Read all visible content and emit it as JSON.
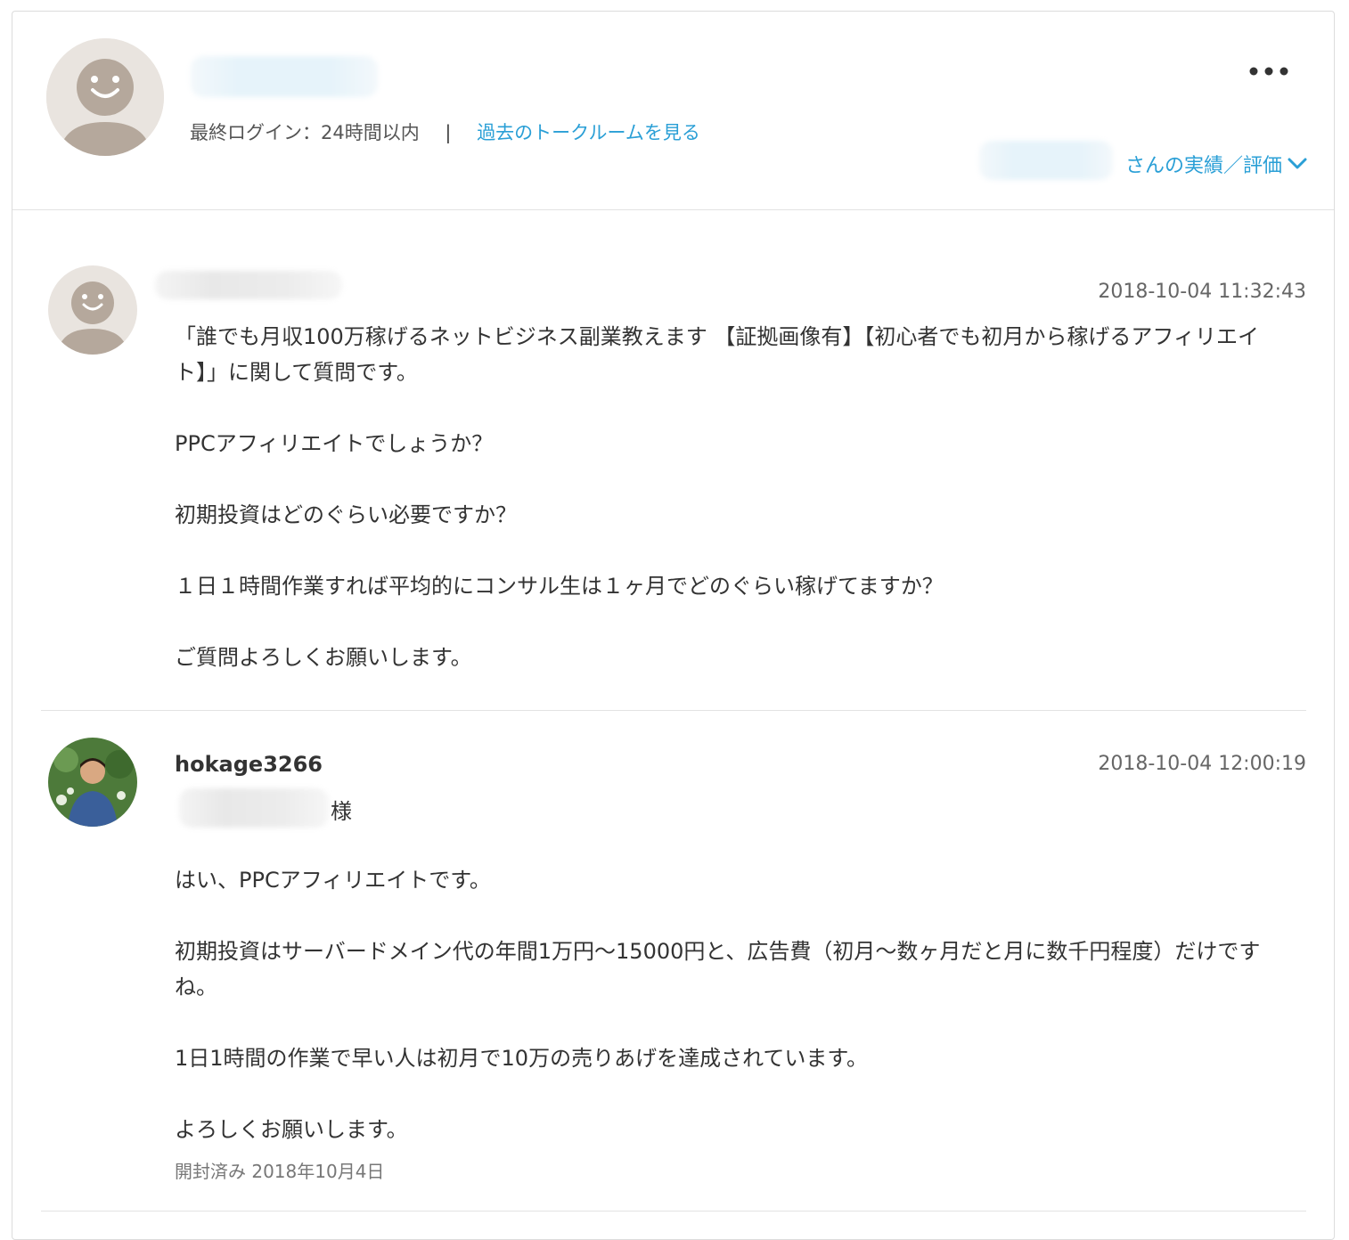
{
  "header": {
    "last_login": "最終ログイン：24時間以内",
    "separator": "|",
    "past_rooms_link": "過去のトークルームを見る",
    "more_icon": "more-horizontal-icon",
    "rating_link_suffix": "さんの実績／評価",
    "chevron_icon": "chevron-down-icon"
  },
  "messages": [
    {
      "sender": "",
      "timestamp": "2018-10-04 11:32:43",
      "lines": [
        "「誰でも月収100万稼げるネットビジネス副業教えます 【証拠画像有】【初心者でも初月から稼げるアフィリエイト】」に関して質問です。",
        "PPCアフィリエイトでしょうか？",
        "初期投資はどのぐらい必要ですか？",
        "１日１時間作業すれば平均的にコンサル生は１ヶ月でどのぐらい稼げてますか？",
        "ご質問よろしくお願いします。"
      ]
    },
    {
      "sender": "hokage3266",
      "timestamp": "2018-10-04 12:00:19",
      "salutation_suffix": "様",
      "lines": [
        "はい、PPCアフィリエイトです。",
        "初期投資はサーバードメイン代の年間1万円〜15000円と、広告費（初月〜数ヶ月だと月に数千円程度）だけですね。",
        "1日1時間の作業で早い人は初月で10万の売りあげを達成されています。",
        "よろしくお願いします。"
      ],
      "read_status": "開封済み 2018年10月4日"
    }
  ],
  "colors": {
    "link": "#2a9fd6",
    "avatar_bg": "#e9e4df",
    "avatar_figure": "#b5a89c",
    "divider": "#e3e3e3"
  }
}
